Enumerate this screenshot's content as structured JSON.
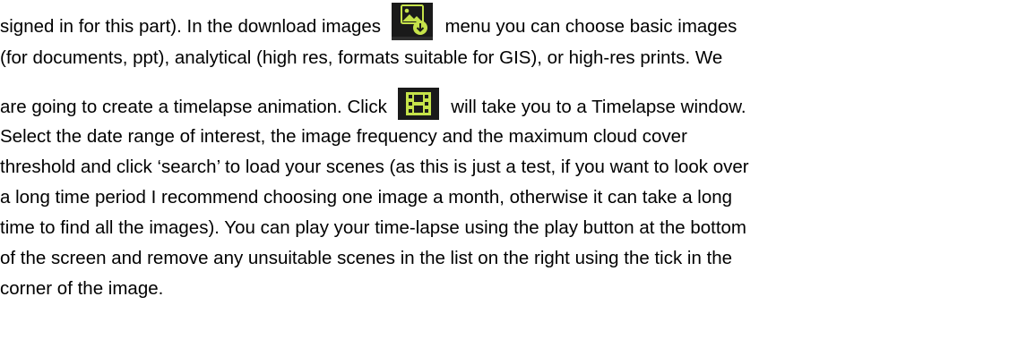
{
  "document": {
    "lines": [
      {
        "before": "signed in for this part). In the download images",
        "after": "menu you can choose basic images"
      },
      {
        "text": "(for documents, ppt), analytical (high res, formats suitable for GIS), or high-res prints.  We"
      },
      {
        "before": "are going to create a timelapse animation. Click",
        "after": "will take you to a Timelapse window."
      },
      {
        "text": "Select the date range of interest, the image frequency and the maximum cloud cover"
      },
      {
        "text": "threshold and click ‘search’ to load your scenes (as this is just a test, if you want to look over"
      },
      {
        "text": "a long time period I recommend choosing one image a month, otherwise it can take a long"
      },
      {
        "text": "time to find all the images). You can play your time-lapse using the play button at the bottom"
      },
      {
        "text": "of the screen and remove any unsuitable scenes in the list on the right using the tick in the"
      },
      {
        "text": "corner of the image."
      }
    ],
    "icons": {
      "download_images": "download-images-icon",
      "timelapse": "timelapse-film-icon"
    },
    "colors": {
      "icon_background": "#1a1a1a",
      "icon_accent": "#c6e34a",
      "text": "#000000"
    }
  }
}
